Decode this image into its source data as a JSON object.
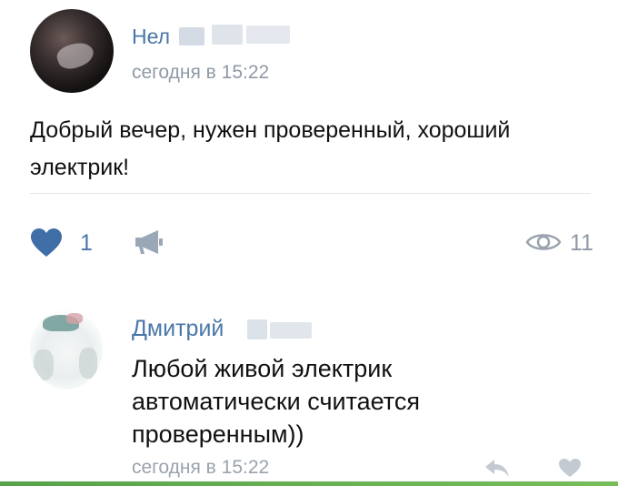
{
  "post": {
    "author_visible": "Нел",
    "time": "сегодня в 15:22",
    "text": "Добрый вечер, нужен проверенный, хороший электрик!",
    "likes": "1",
    "views": "11"
  },
  "comment": {
    "author_visible": "Дмитрий",
    "text": "Любой живой электрик автоматически считается проверенным))",
    "time": "сегодня в 15:22"
  },
  "colors": {
    "link_blue": "#4a77a8",
    "muted_gray": "#8f9aa6",
    "like_blue": "#3f6fa6"
  },
  "icons": {
    "like": "heart-icon",
    "share": "megaphone-icon",
    "views": "eye-icon",
    "reply": "reply-arrow-icon",
    "comment_like": "heart-outline-icon"
  }
}
